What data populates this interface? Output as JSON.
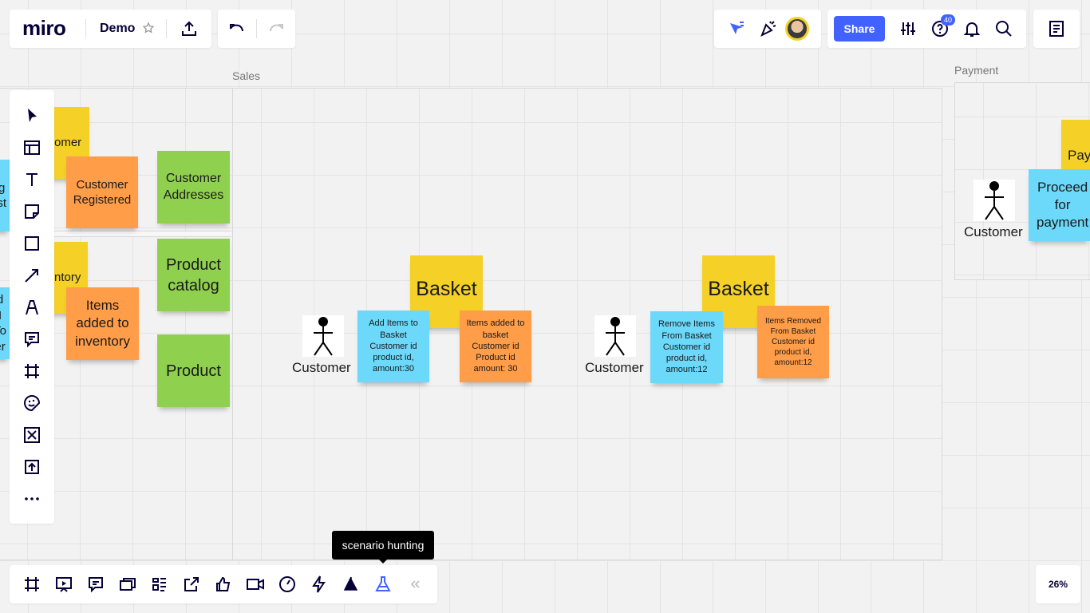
{
  "app": {
    "logo": "miro",
    "board_title": "Demo",
    "share_label": "Share",
    "notification_count": "40",
    "zoom": "26%"
  },
  "frames": {
    "sales_label": "Sales",
    "payment_label": "Payment"
  },
  "left_stickies": {
    "customer_partial": "omer",
    "customer_registered": "Customer Registered",
    "customer_addresses": "Customer Addresses",
    "inventory_partial": "ntory",
    "items_added_inventory": "Items added to inventory",
    "product_catalog": "Product catalog",
    "product": "Product",
    "blue_partial_top": "eg\nust",
    "blue_partial_bottom": "d I\nTo\ner"
  },
  "scenario1": {
    "aggregate": "Basket",
    "actor": "Customer",
    "command": "Add Items to Basket Customer id product id, amount:30",
    "event": "Items added to basket Customer id Product id amount: 30"
  },
  "scenario2": {
    "aggregate": "Basket",
    "actor": "Customer",
    "command": "Remove Items From Basket Customer id product id, amount:12",
    "event": "Items Removed From Basket Customer id product id, amount:12"
  },
  "payment": {
    "actor": "Customer",
    "command": "Proceed for payment",
    "yellow_partial": "Pay"
  },
  "tooltip": {
    "text": "scenario hunting"
  },
  "colors": {
    "accent": "#4262ff",
    "yellow": "#f5d128",
    "orange": "#ff9d48",
    "blue": "#6cd8fa",
    "green": "#8fd14f"
  }
}
